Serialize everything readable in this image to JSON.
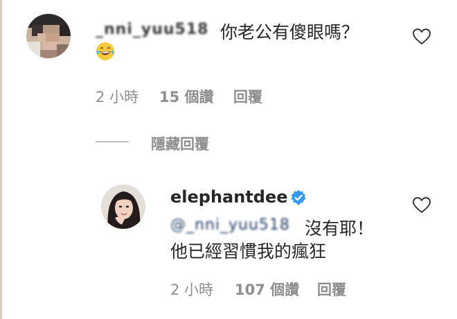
{
  "comment": {
    "username": "_nni_yuu518",
    "text": "你老公有傻眼嗎？",
    "emoji": "face-with-tears-of-joy",
    "time": "2 小時",
    "likes": "15 個讚",
    "reply": "回覆"
  },
  "hide_replies": "隱藏回覆",
  "reply": {
    "username": "elephantdee",
    "verified": true,
    "mention": "@_nni_yuu518",
    "text_line1": "沒有耶！",
    "text_line2": "他已經習慣我的瘋狂",
    "time": "2 小時",
    "likes": "107 個讚",
    "reply": "回覆"
  },
  "colors": {
    "text": "#262626",
    "secondary": "#8e8e8e",
    "verified_blue": "#3897f0",
    "mention": "#1f3a63"
  }
}
